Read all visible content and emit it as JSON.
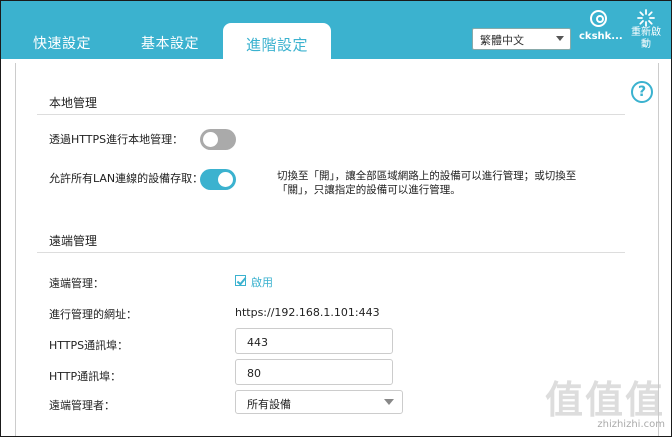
{
  "tabs": [
    {
      "label": "快速設定",
      "active": false
    },
    {
      "label": "基本設定",
      "active": false
    },
    {
      "label": "進階設定",
      "active": true
    }
  ],
  "header": {
    "language": "繁體中文",
    "user_label": "ckshk...",
    "reboot_label": "重新啟動"
  },
  "local": {
    "title": "本地管理",
    "https_label": "透過HTTPS進行本地管理：",
    "https_enabled": false,
    "lan_label": "允許所有LAN連線的設備存取：",
    "lan_enabled": true,
    "note": "切換至「開」，讓全部區域網路上的設備可以進行管理；或切換至「關」，只讓指定的設備可以進行管理。"
  },
  "remote": {
    "title": "遠端管理",
    "remote_label": "遠端管理：",
    "enable_label": "啟用",
    "enabled": true,
    "url_label": "進行管理的網址：",
    "url_value": "https://192.168.1.101:443",
    "https_port_label": "HTTPS通訊埠：",
    "https_port_value": "443",
    "http_port_label": "HTTP通訊埠：",
    "http_port_value": "80",
    "manager_label": "遠端管理者：",
    "manager_value": "所有設備"
  },
  "watermark": {
    "big": "值值值",
    "small": "zhizhizhi.com"
  },
  "colors": {
    "accent": "#3bb2cf",
    "toggle_off": "#aaaaaa"
  }
}
